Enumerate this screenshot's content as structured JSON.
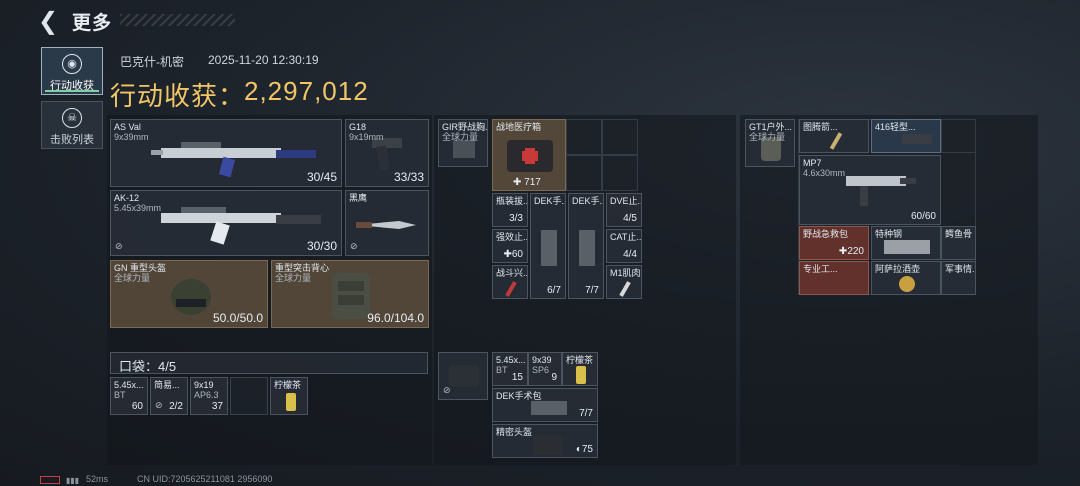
{
  "header": {
    "title": "更多"
  },
  "sidebar": {
    "tabs": [
      {
        "label": "行动收获",
        "active": true
      },
      {
        "label": "击败列表",
        "active": false
      }
    ]
  },
  "summary": {
    "map": "巴克什-机密",
    "datetime": "2025-11-20 12:30:19",
    "total_label": "行动收获：",
    "total_value": "2,297,012"
  },
  "loadout": {
    "weapon1": {
      "name": "AS Val",
      "caliber": "9x39mm",
      "ammo": "30/45"
    },
    "sidearm": {
      "name": "G18",
      "caliber": "9x19mm",
      "ammo": "33/33"
    },
    "weapon2": {
      "name": "AK-12",
      "caliber": "5.45x39mm",
      "ammo": "30/30"
    },
    "melee": {
      "name": "黑鹰"
    },
    "helmet": {
      "name": "GN 重型头盔",
      "faction": "全球力量",
      "durability": "50.0/50.0"
    },
    "armor": {
      "name": "重型突击背心",
      "faction": "全球力量",
      "durability": "96.0/104.0"
    }
  },
  "chest_rig": {
    "name": "GIR野战胸...",
    "faction": "全球力量",
    "items": [
      {
        "name": "战地医疗箱",
        "qty": "717"
      },
      {
        "name": "瓶装拔...",
        "qty": "3/3"
      },
      {
        "name": "强效止...",
        "qty": "60"
      },
      {
        "name": "战斗兴...",
        "qty": ""
      },
      {
        "name": "DEK手...",
        "qty": "6/7"
      },
      {
        "name": "DEK手...",
        "qty": "7/7"
      },
      {
        "name": "DVE止...",
        "qty": "4/5"
      },
      {
        "name": "CAT止...",
        "qty": "4/4"
      },
      {
        "name": "M1肌肉...",
        "qty": ""
      }
    ]
  },
  "backpack": {
    "name": "GT1户外...",
    "faction": "全球力量",
    "items": [
      {
        "name": "图腾箭...",
        "qty": ""
      },
      {
        "name": "416轻型...",
        "qty": ""
      },
      {
        "name": "MP7",
        "caliber": "4.6x30mm",
        "qty": "60/60"
      },
      {
        "name": "野战急救包",
        "qty": "220"
      },
      {
        "name": "特种钢",
        "qty": ""
      },
      {
        "name": "鳄鱼骨",
        "qty": ""
      },
      {
        "name": "专业工...",
        "qty": ""
      },
      {
        "name": "阿萨拉酒壶",
        "qty": ""
      },
      {
        "name": "军事情...",
        "qty": ""
      }
    ]
  },
  "pocket": {
    "label": "口袋：4/5",
    "items": [
      {
        "name": "5.45x...",
        "sub": "BT",
        "qty": "60"
      },
      {
        "name": "简易...",
        "qty": "2/2"
      },
      {
        "name": "9x19",
        "sub": "AP6.3",
        "qty": "37"
      },
      {
        "name": "柠檬茶",
        "qty": ""
      }
    ]
  },
  "safe_box": {
    "items": [
      {
        "name": "5.45x...",
        "sub": "BT",
        "qty": "15"
      },
      {
        "name": "9x39",
        "sub": "SP6",
        "qty": "9"
      },
      {
        "name": "柠檬茶",
        "qty": ""
      },
      {
        "name": "DEK手术包",
        "qty": "7/7"
      },
      {
        "name": "精密头盔",
        "qty": "75"
      }
    ]
  },
  "status_bar": {
    "ping": "52ms",
    "uid": "CN UID:7205625211081 2956090"
  },
  "colors": {
    "accent_gold": "#f0c667",
    "active_tab_underline": "#7fd0a0"
  }
}
